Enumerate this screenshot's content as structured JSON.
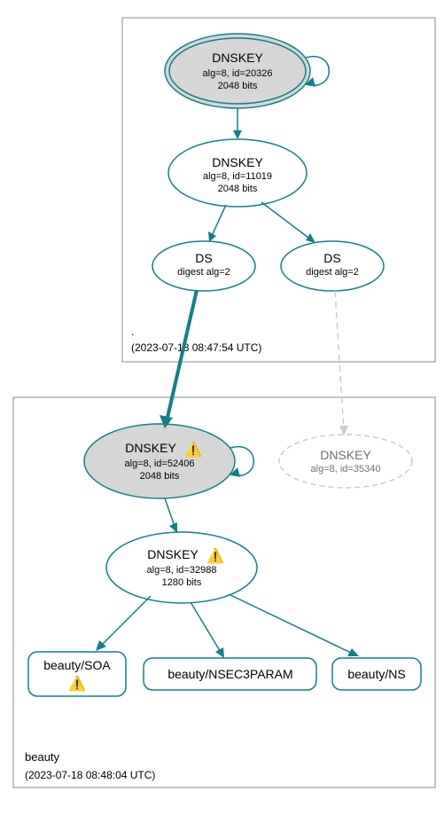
{
  "zones": [
    {
      "name": ".",
      "timestamp": "(2023-07-18 08:47:54 UTC)"
    },
    {
      "name": "beauty",
      "timestamp": "(2023-07-18 08:48:04 UTC)"
    }
  ],
  "nodes": {
    "root_ksk": {
      "title": "DNSKEY",
      "line1": "alg=8, id=20326",
      "line2": "2048 bits"
    },
    "root_zsk": {
      "title": "DNSKEY",
      "line1": "alg=8, id=11019",
      "line2": "2048 bits"
    },
    "ds1": {
      "title": "DS",
      "line1": "digest alg=2"
    },
    "ds2": {
      "title": "DS",
      "line1": "digest alg=2"
    },
    "beauty_ksk": {
      "title": "DNSKEY",
      "line1": "alg=8, id=52406",
      "line2": "2048 bits",
      "warn": "⚠️"
    },
    "beauty_unknown": {
      "title": "DNSKEY",
      "line1": "alg=8, id=35340"
    },
    "beauty_zsk": {
      "title": "DNSKEY",
      "line1": "alg=8, id=32988",
      "line2": "1280 bits",
      "warn": "⚠️"
    },
    "rr_soa": {
      "title": "beauty/SOA",
      "warn": "⚠️"
    },
    "rr_nsec3": {
      "title": "beauty/NSEC3PARAM"
    },
    "rr_ns": {
      "title": "beauty/NS"
    }
  },
  "colors": {
    "stroke": "#10808a",
    "ksk_fill": "#d6d6d6",
    "box": "#888888",
    "dashed": "#cccccc"
  }
}
